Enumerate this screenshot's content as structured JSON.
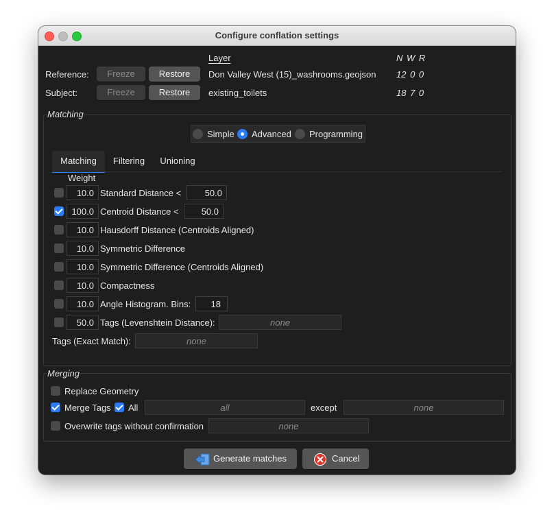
{
  "window": {
    "title": "Configure conflation settings"
  },
  "layers": {
    "layer_header": "Layer",
    "nwr_header": "N  W  R",
    "reference": {
      "label": "Reference:",
      "freeze": "Freeze",
      "restore": "Restore",
      "layer_name": "Don Valley West (15)_washrooms.geojson",
      "nwr": "12  0  0"
    },
    "subject": {
      "label": "Subject:",
      "freeze": "Freeze",
      "restore": "Restore",
      "layer_name": "existing_toilets",
      "nwr": "18  7  0"
    }
  },
  "matching": {
    "group_title": "Matching",
    "modes": [
      {
        "label": "Simple",
        "selected": false
      },
      {
        "label": "Advanced",
        "selected": true
      },
      {
        "label": "Programming",
        "selected": false
      }
    ],
    "tabs": [
      {
        "label": "Matching",
        "active": true
      },
      {
        "label": "Filtering",
        "active": false
      },
      {
        "label": "Unioning",
        "active": false
      }
    ],
    "weight_header": "Weight",
    "rows": [
      {
        "checked": false,
        "weight": "10.0",
        "label": "Standard Distance <",
        "param": "50.0"
      },
      {
        "checked": true,
        "weight": "100.0",
        "label": "Centroid Distance <",
        "param": "50.0"
      },
      {
        "checked": false,
        "weight": "10.0",
        "label": "Hausdorff Distance (Centroids Aligned)"
      },
      {
        "checked": false,
        "weight": "10.0",
        "label": "Symmetric Difference"
      },
      {
        "checked": false,
        "weight": "10.0",
        "label": "Symmetric Difference (Centroids Aligned)"
      },
      {
        "checked": false,
        "weight": "10.0",
        "label": "Compactness"
      },
      {
        "checked": false,
        "weight": "10.0",
        "label": "Angle Histogram. Bins:",
        "param": "18"
      },
      {
        "checked": false,
        "weight": "50.0",
        "label": "Tags (Levenshtein Distance):",
        "placeholder": "none"
      }
    ],
    "exact_match": {
      "label": "Tags (Exact Match):",
      "placeholder": "none"
    }
  },
  "merging": {
    "group_title": "Merging",
    "replace_geometry": {
      "label": "Replace Geometry",
      "checked": false
    },
    "merge_tags": {
      "label": "Merge Tags",
      "checked": true
    },
    "all": {
      "label": "All",
      "checked": true
    },
    "tags_placeholder": "all",
    "except_label": "except",
    "except_placeholder": "none",
    "overwrite": {
      "label": "Overwrite tags without confirmation",
      "checked": false,
      "placeholder": "none"
    }
  },
  "actions": {
    "generate": "Generate matches",
    "cancel": "Cancel"
  },
  "colors": {
    "accent": "#2a7cf6",
    "background": "#1e1e1e",
    "button": "#555556",
    "cancel_icon": "#e0352b"
  }
}
